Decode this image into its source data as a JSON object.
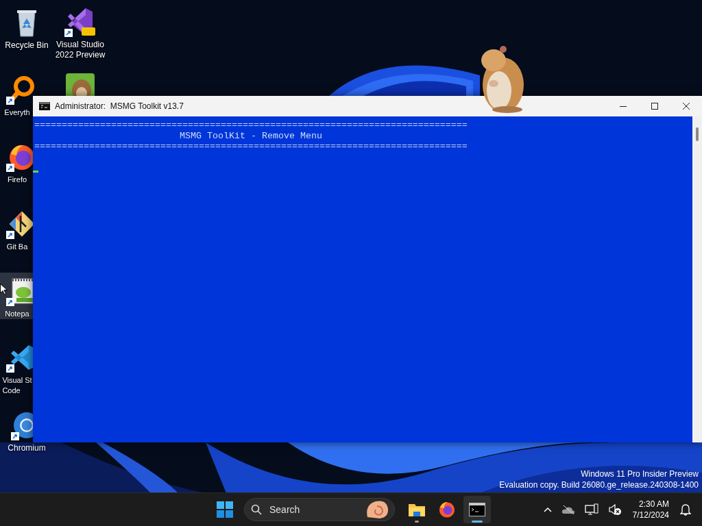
{
  "desktop": {
    "icons": [
      {
        "kind": "recycle-bin",
        "label": [
          "Recycle Bin"
        ],
        "shortcut": false,
        "selected": false
      },
      {
        "kind": "everything",
        "label": [
          "Everyth"
        ],
        "shortcut": true,
        "selected": false
      },
      {
        "kind": "firefox",
        "label": [
          "Firefo"
        ],
        "shortcut": true,
        "selected": false
      },
      {
        "kind": "git",
        "label": [
          "Git Ba"
        ],
        "shortcut": true,
        "selected": false
      },
      {
        "kind": "notepad",
        "label": [
          "Notepa"
        ],
        "shortcut": true,
        "selected": true
      },
      {
        "kind": "vscode",
        "label": [
          "Visual St",
          "Code"
        ],
        "shortcut": true,
        "selected": false
      },
      {
        "kind": "chromium",
        "label": [
          "Chromium"
        ],
        "shortcut": true,
        "selected": false
      }
    ],
    "icons_column_2": [
      {
        "kind": "visual-studio",
        "label": [
          "Visual Studio",
          "2022 Preview"
        ],
        "shortcut": true,
        "selected": false
      },
      {
        "kind": "beaver",
        "shortcut": false,
        "selected": false
      }
    ],
    "os_notice": [
      "Windows 11 Pro Insider Preview",
      "Evaluation copy. Build 26080.ge_release.240308-1400"
    ]
  },
  "window": {
    "title": "Administrator:  MSMG Toolkit v13.7",
    "console_lines": [
      {
        "kind": "rule",
        "text": "==============================================================================="
      },
      {
        "kind": "heading",
        "text": "MSMG ToolKit - Remove Menu"
      },
      {
        "kind": "rule",
        "text": "==============================================================================="
      }
    ]
  },
  "taskbar": {
    "search": {
      "placeholder": "Search"
    },
    "apps": [
      {
        "kind": "file-explorer",
        "open": true,
        "selected": false
      },
      {
        "kind": "firefox",
        "open": false,
        "selected": false
      },
      {
        "kind": "terminal",
        "open": true,
        "selected": true
      }
    ],
    "clock": {
      "time": "2:30 AM",
      "date": "7/12/2024"
    }
  }
}
